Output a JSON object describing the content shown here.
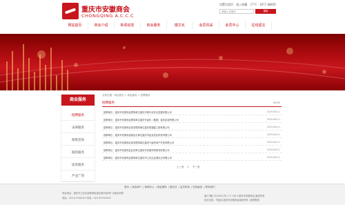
{
  "header": {
    "logo_cn": "重庆市安徽商会",
    "logo_en": "CHONGQING  A.C.C.C",
    "toplinks": [
      "设置为首页",
      "加入收藏",
      "17°C - 28°C 晴转阴"
    ],
    "search_placeholder": "请输入关键字",
    "search_button": "搜索"
  },
  "nav": [
    {
      "label": "网站首页"
    },
    {
      "label": "商会介绍"
    },
    {
      "label": "新闻动态"
    },
    {
      "label": "商会服务"
    },
    {
      "label": "徽文化"
    },
    {
      "label": "会员风采"
    },
    {
      "label": "会员中心"
    },
    {
      "label": "在线留言"
    }
  ],
  "sidebar": {
    "title": "商会服务",
    "items": [
      {
        "label": "招聘服务"
      },
      {
        "label": "法律服务"
      },
      {
        "label": "政策咨询"
      },
      {
        "label": "融资服务"
      },
      {
        "label": "投资服务"
      },
      {
        "label": "产业广场"
      }
    ]
  },
  "breadcrumb": "当前位置：网站首页 > 商会服务 > 招聘服务",
  "section": {
    "title": "招聘服务",
    "more": "MORE"
  },
  "rows": [
    {
      "text": "招聘单位：重庆市安徽商会理事单位重庆市现代化农业发展有限公司",
      "date": "2019-06-11"
    },
    {
      "text": "招聘单位：重庆市安徽商会理事单位重庆市金科（集团）重庆区域有限公司",
      "date": "2019-06-11"
    },
    {
      "text": "招聘单位：重庆市安徽商会常务理事单位重庆恒福建工程有限公司",
      "date": "2019-06-11"
    },
    {
      "text": "招聘单位：重庆市安徽商会副会长单位重庆市金龙世纪科技有限公司",
      "date": "2019-06-11"
    },
    {
      "text": "招聘单位：重庆市安徽商会常务理事单位重庆兴鑫房地产开发有限公司",
      "date": "2019-06-11"
    },
    {
      "text": "招聘单位：重庆市安徽商会会员单位重庆市安徽商贸物流有限公司",
      "date": "2019-06-11"
    },
    {
      "text": "招聘单位：重庆市安徽商会理事单位重庆市江北区金源实业有限公司",
      "date": "2019-06-11"
    }
  ],
  "pager": [
    "上一页",
    "1",
    "下一页"
  ],
  "footer": {
    "links": [
      "首页",
      "商会简介",
      "新闻中心",
      "商会服务",
      "徽文化",
      "会员风采",
      "在线留言",
      "联系我们"
    ],
    "left1": "商会地址：重庆市江北区观音桥街道北城天街6号 大都会商厦",
    "left2": "电话：023-6739XXXX    传真：023-6739XXXX",
    "right1": "渝ICP备17010811号-1    © 2019 重庆市安徽商会 版权所有",
    "right2": "技术支持：华智创    重庆市安徽商会版权所有 | 管理登录"
  }
}
